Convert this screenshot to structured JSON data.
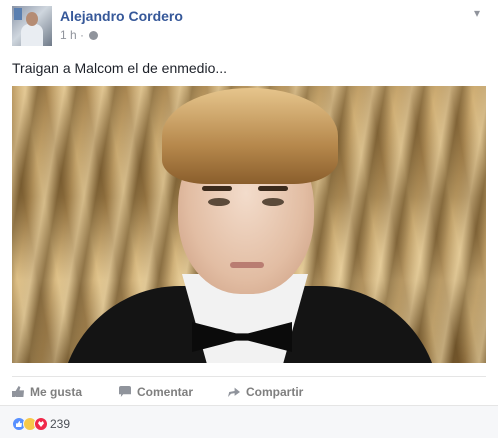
{
  "post": {
    "author": "Alejandro Cordero",
    "time": "1 h",
    "separator": "·",
    "text": "Traigan a Malcom el de enmedio..."
  },
  "actions": {
    "like": "Me gusta",
    "comment": "Comentar",
    "share": "Compartir"
  },
  "footer": {
    "reaction_count": "239",
    "reactions": [
      "like-reaction-icon",
      "haha-reaction-icon",
      "love-reaction-icon"
    ]
  },
  "colors": {
    "author_link": "#365899",
    "muted": "#90949c",
    "like_blue": "#5890ff",
    "haha_yellow": "#f7c94a",
    "love_red": "#f0284a"
  },
  "icons": {
    "privacy": "globe-icon",
    "menu": "chevron-down-icon",
    "like": "thumbs-up-icon",
    "comment": "comment-bubble-icon",
    "share": "share-arrow-icon"
  }
}
